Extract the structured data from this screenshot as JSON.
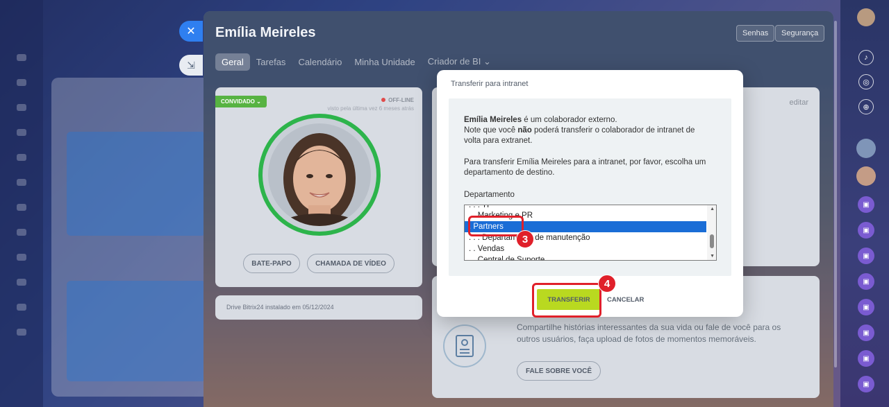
{
  "slider": {
    "title": "Emília Meireles",
    "header_buttons": [
      "Senhas",
      "Segurança"
    ],
    "tabs": [
      "Geral",
      "Tarefas",
      "Calendário",
      "Minha Unidade",
      "Criador de BI ⌄"
    ],
    "profile": {
      "badge": "CONVIDADO ⌄",
      "status": "OFF-LINE",
      "last_seen": "visto pela última vez 6 meses atrás",
      "chat_button": "BATE-PAPO",
      "video_button": "CHAMADA DE VÍDEO"
    },
    "drive_text": "Drive Bitrix24 instalado em 05/12/2024",
    "edit_link": "editar",
    "share_text": "Compartilhe histórias interessantes da sua vida ou fale de você para os outros usuários, faça upload de fotos de momentos memoráveis.",
    "share_button": "FALE SOBRE VOCÊ"
  },
  "modal": {
    "title": "Transferir para intranet",
    "name_bold": "Emília Meireles",
    "line1_rest": " é um colaborador externo.",
    "line2_a": "Note que você ",
    "line2_bold": "não",
    "line2_b": " poderá transferir o colaborador de intranet de",
    "line3": "volta para extranet.",
    "para2_line1": "Para transferir Emília Meireles para a intranet, por favor, escolha um",
    "para2_line2": "departamento de destino.",
    "department_label": "Departamento",
    "options": [
      ". . . TI",
      ". . Marketing e PR",
      ". Partners",
      ". . . Departamento de manutenção",
      ". . Vendas",
      ". . Central de Suporte"
    ],
    "selected_option": ". Partners",
    "transfer_button": "TRANSFERIR",
    "cancel_button": "CANCELAR"
  },
  "annotations": {
    "step3": "3",
    "step4": "4"
  },
  "colors": {
    "accent_blue": "#2f7ff0",
    "transfer_green": "#b9d920",
    "highlight_red": "#e0202a",
    "online_ring": "#2db44b"
  }
}
